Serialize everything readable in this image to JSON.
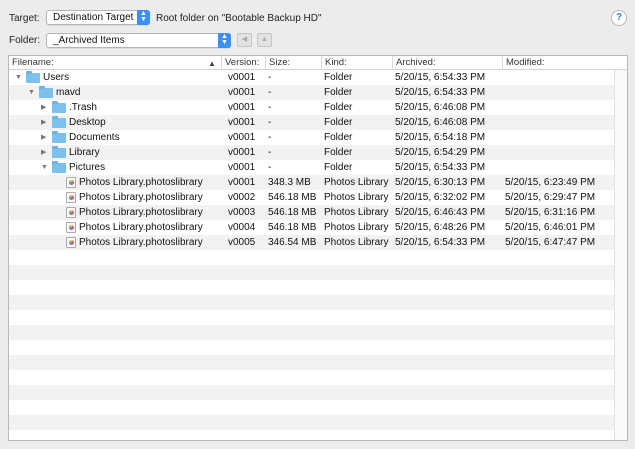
{
  "header": {
    "target_label": "Target:",
    "target_value": "Destination Target",
    "target_desc": "Root folder on \"Bootable Backup HD\"",
    "folder_label": "Folder:",
    "folder_value": "_Archived Items",
    "help_glyph": "?",
    "back_glyph": "◀",
    "up_glyph": "▲"
  },
  "table": {
    "columns": [
      "Filename:",
      "Version:",
      "Size:",
      "Kind:",
      "Archived:",
      "Modified:"
    ],
    "sort_glyph": "▲",
    "rows": [
      {
        "indent": 0,
        "disclosure": "▼",
        "icon": "folder",
        "name": "Users",
        "version": "v0001",
        "size": "-",
        "kind": "Folder",
        "archived": "5/20/15, 6:54:33 PM",
        "modified": ""
      },
      {
        "indent": 1,
        "disclosure": "▼",
        "icon": "folder",
        "name": "mavd",
        "version": "v0001",
        "size": "-",
        "kind": "Folder",
        "archived": "5/20/15, 6:54:33 PM",
        "modified": ""
      },
      {
        "indent": 2,
        "disclosure": "▶",
        "icon": "folder",
        "name": ".Trash",
        "version": "v0001",
        "size": "-",
        "kind": "Folder",
        "archived": "5/20/15, 6:46:08 PM",
        "modified": ""
      },
      {
        "indent": 2,
        "disclosure": "▶",
        "icon": "folder",
        "name": "Desktop",
        "version": "v0001",
        "size": "-",
        "kind": "Folder",
        "archived": "5/20/15, 6:46:08 PM",
        "modified": ""
      },
      {
        "indent": 2,
        "disclosure": "▶",
        "icon": "folder",
        "name": "Documents",
        "version": "v0001",
        "size": "-",
        "kind": "Folder",
        "archived": "5/20/15, 6:54:18 PM",
        "modified": ""
      },
      {
        "indent": 2,
        "disclosure": "▶",
        "icon": "folder",
        "name": "Library",
        "version": "v0001",
        "size": "-",
        "kind": "Folder",
        "archived": "5/20/15, 6:54:29 PM",
        "modified": ""
      },
      {
        "indent": 2,
        "disclosure": "▼",
        "icon": "folder",
        "name": "Pictures",
        "version": "v0001",
        "size": "-",
        "kind": "Folder",
        "archived": "5/20/15, 6:54:33 PM",
        "modified": ""
      },
      {
        "indent": 3,
        "disclosure": "",
        "icon": "photos",
        "name": "Photos Library.photoslibrary",
        "version": "v0001",
        "size": "348.3 MB",
        "kind": "Photos Library",
        "archived": "5/20/15, 6:30:13 PM",
        "modified": "5/20/15, 6:23:49 PM"
      },
      {
        "indent": 3,
        "disclosure": "",
        "icon": "photos",
        "name": "Photos Library.photoslibrary",
        "version": "v0002",
        "size": "546.18 MB",
        "kind": "Photos Library",
        "archived": "5/20/15, 6:32:02 PM",
        "modified": "5/20/15, 6:29:47 PM"
      },
      {
        "indent": 3,
        "disclosure": "",
        "icon": "photos",
        "name": "Photos Library.photoslibrary",
        "version": "v0003",
        "size": "546.18 MB",
        "kind": "Photos Library",
        "archived": "5/20/15, 6:46:43 PM",
        "modified": "5/20/15, 6:31:16 PM"
      },
      {
        "indent": 3,
        "disclosure": "",
        "icon": "photos",
        "name": "Photos Library.photoslibrary",
        "version": "v0004",
        "size": "546.18 MB",
        "kind": "Photos Library",
        "archived": "5/20/15, 6:48:26 PM",
        "modified": "5/20/15, 6:46:01 PM"
      },
      {
        "indent": 3,
        "disclosure": "",
        "icon": "photos",
        "name": "Photos Library.photoslibrary",
        "version": "v0005",
        "size": "346.54 MB",
        "kind": "Photos Library",
        "archived": "5/20/15, 6:54:33 PM",
        "modified": "5/20/15, 6:47:47 PM"
      }
    ]
  },
  "colors": {
    "accent": "#3b8ff5",
    "stripe": "#f2f2f2",
    "folder": "#7cc0ee"
  }
}
